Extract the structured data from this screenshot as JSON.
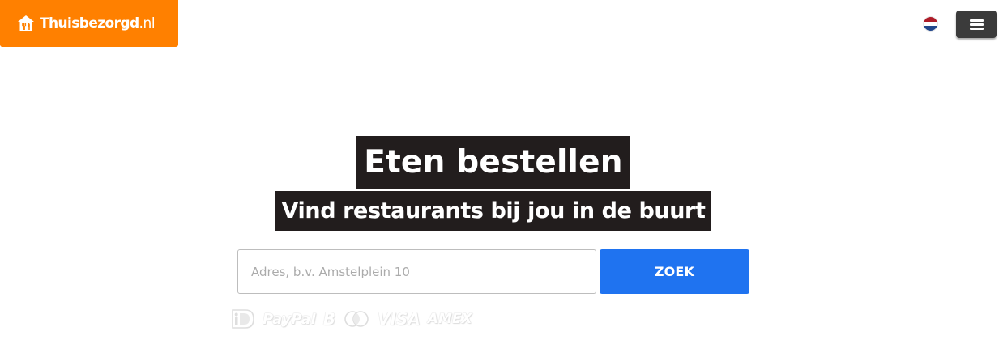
{
  "header": {
    "logo": {
      "brand": "Thuisbezorgd",
      "tld": ".nl",
      "icon": "house-fork-icon"
    },
    "language": {
      "icon": "flag-nl-icon"
    },
    "menu": {
      "icon": "hamburger-icon"
    }
  },
  "hero": {
    "title": "Eten bestellen",
    "subtitle": "Vind restaurants bij jou in de buurt"
  },
  "search": {
    "placeholder": "Adres, b.v. Amstelplein 10",
    "value": "",
    "button_label": "ZOEK"
  },
  "payment_methods": [
    {
      "name": "ideal-icon"
    },
    {
      "name": "paypal-icon",
      "label": "PayPal"
    },
    {
      "name": "bitcoin-icon",
      "label": "B"
    },
    {
      "name": "mastercard-icon"
    },
    {
      "name": "visa-icon",
      "label": "VISA"
    },
    {
      "name": "amex-icon",
      "label": "AMEX"
    }
  ],
  "colors": {
    "brand_orange": "#ff8000",
    "hero_background": "#221d1d",
    "search_button": "#1f73f0",
    "menu_button": "#3b3b3b"
  }
}
